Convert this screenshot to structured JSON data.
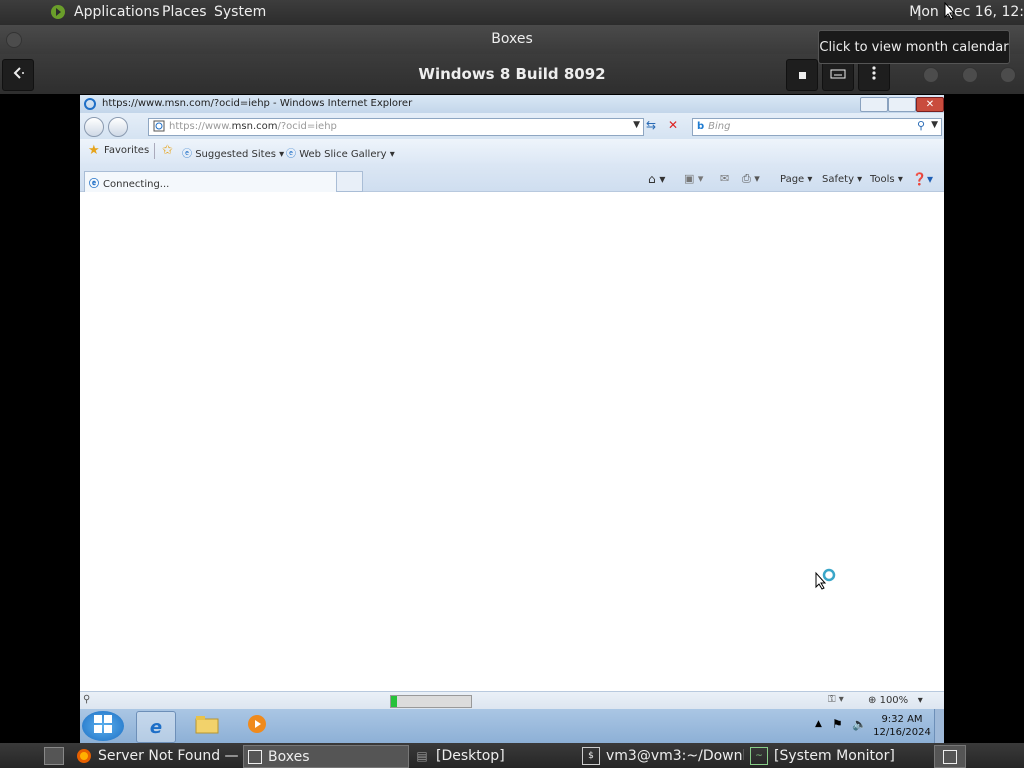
{
  "top_panel": {
    "menus": [
      "Applications",
      "Places",
      "System"
    ],
    "clock": "Mon Dec 16, 12:"
  },
  "boxes": {
    "window_title": "Boxes",
    "vm_title": "Windows 8 Build 8092",
    "tooltip": "Click to view month calendar"
  },
  "ie": {
    "window_title": "https://www.msn.com/?ocid=iehp - Windows Internet Explorer",
    "address_prefix": "https://www.",
    "address_domain": "msn.com",
    "address_path": "/?ocid=iehp",
    "search_placeholder": "Bing",
    "favorites_label": "Favorites",
    "suggested_sites": "Suggested Sites",
    "web_slice_gallery": "Web Slice Gallery",
    "tab_label": "Connecting...",
    "cmd_page": "Page",
    "cmd_safety": "Safety",
    "cmd_tools": "Tools",
    "zoom": "100%",
    "progress": 0.08
  },
  "guest_taskbar": {
    "time": "9:32 AM",
    "date": "12/16/2024"
  },
  "bottom_panel": {
    "tasks": [
      "Server Not Found —...",
      "Boxes",
      "[Desktop]",
      "vm3@vm3:~/Downl...",
      "[System Monitor]"
    ]
  },
  "colors": {
    "panel_bg": "#2c2c2c",
    "ie_chrome": "#d5e3f2",
    "win_taskbar": "#8db0d6",
    "progress_green": "#26c23a"
  },
  "icons": [
    "gnome-foot-icon",
    "window-icon",
    "back-arrow-icon",
    "stop-icon",
    "keyboard-icon",
    "menu-icon",
    "ie-page-icon",
    "refresh-icon",
    "stop-x-icon",
    "bing-icon",
    "search-icon",
    "favorites-star-icon",
    "add-favorite-icon",
    "home-icon",
    "feeds-icon",
    "mail-icon",
    "print-icon",
    "help-icon",
    "zoom-icon",
    "windows-start-icon",
    "ie-icon",
    "folder-icon",
    "media-player-icon",
    "busy-cursor-icon",
    "firefox-icon",
    "terminal-icon",
    "monitor-icon",
    "show-desktop-icon"
  ]
}
